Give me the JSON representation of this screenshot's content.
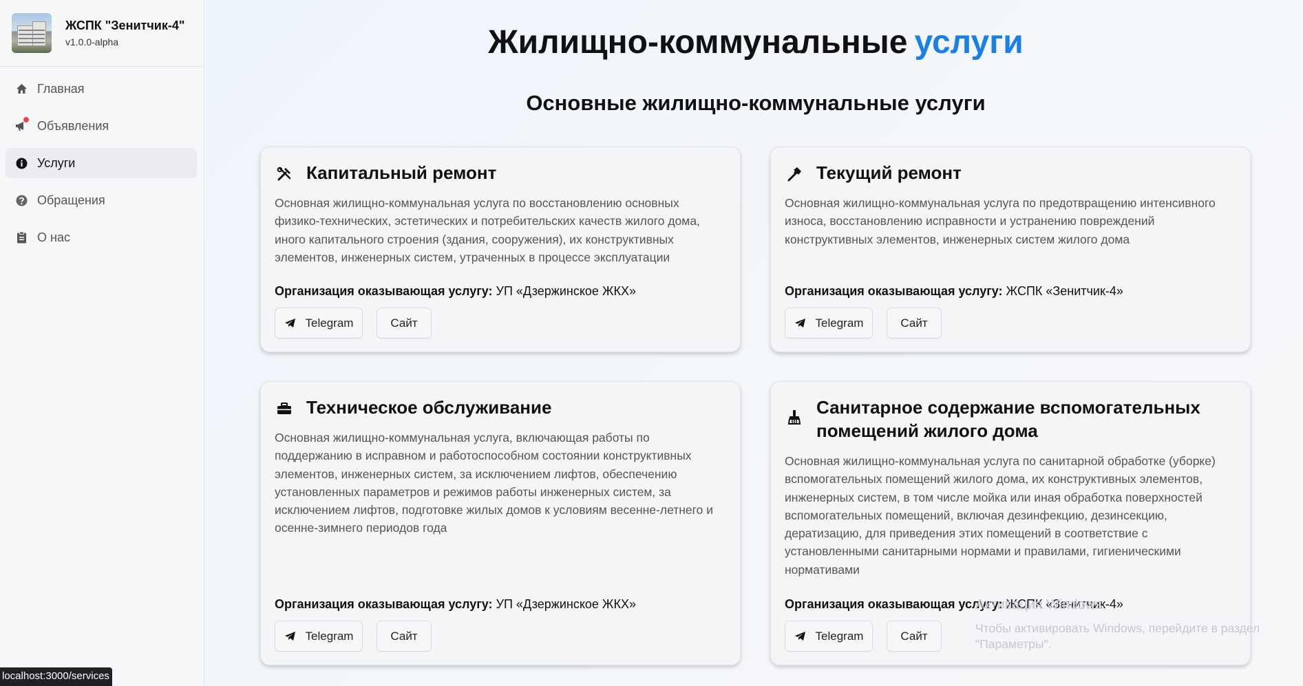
{
  "app": {
    "title": "ЖСПК \"Зенитчик-4\"",
    "version": "v1.0.0-alpha"
  },
  "nav": {
    "items": [
      {
        "label": "Главная",
        "icon": "home-icon"
      },
      {
        "label": "Объявления",
        "icon": "megaphone-icon",
        "badge": true
      },
      {
        "label": "Услуги",
        "icon": "info-icon",
        "active": true
      },
      {
        "label": "Обращения",
        "icon": "question-icon"
      },
      {
        "label": "О нас",
        "icon": "clipboard-icon"
      }
    ]
  },
  "page": {
    "title_main": "Жилищно-коммунальные",
    "title_accent": "услуги",
    "section_title": "Основные жилищно-коммунальные услуги",
    "accent_color": "#1a7fe6"
  },
  "org_label": "Организация оказывающая услугу:",
  "cards": [
    {
      "title": "Капитальный ремонт",
      "icon": "tools-icon",
      "description": "Основная жилищно-коммунальная услуга по восстановлению основных физико-технических, эстетических и потребительских качеств жилого дома, иного капитального строения (здания, сооружения), их конструктивных элементов, инженерных систем, утраченных в процессе эксплуатации",
      "org": "УП «Дзержинское ЖКХ»",
      "telegram_label": "Telegram",
      "site_label": "Сайт"
    },
    {
      "title": "Текущий ремонт",
      "icon": "hammer-icon",
      "description": "Основная жилищно-коммунальная услуга по предотвращению интенсивного износа, восстановлению исправности и устранению повреждений конструктивных элементов, инженерных систем жилого дома",
      "org": "ЖСПК «Зенитчик-4»",
      "telegram_label": "Telegram",
      "site_label": "Сайт"
    },
    {
      "title": "Техническое обслуживание",
      "icon": "toolbox-icon",
      "description": "Основная жилищно-коммунальная услуга, включающая работы по поддержанию в исправном и работоспособном состоянии конструктивных элементов, инженерных систем, за исключением лифтов, обеспечению установленных параметров и режимов работы инженерных систем, за исключением лифтов, подготовке жилых домов к условиям весенне-летнего и осенне-зимнего периодов года",
      "org": "УП «Дзержинское ЖКХ»",
      "telegram_label": "Telegram",
      "site_label": "Сайт"
    },
    {
      "title": "Санитарное содержание вспомогательных помещений жилого дома",
      "icon": "broom-icon",
      "description": "Основная жилищно-коммунальная услуга по санитарной обработке (уборке) вспомогательных помещений жилого дома, их конструктивных элементов, инженерных систем, в том числе мойка или иная обработка поверхностей вспомогательных помещений, включая дезинфекцию, дезинсекцию, дератизацию, для приведения этих помещений в соответствие с установленными санитарными нормами и правилами, гигиеническими нормативами",
      "org": "ЖСПК «Зенитчик-4»",
      "telegram_label": "Telegram",
      "site_label": "Сайт"
    }
  ],
  "watermark": {
    "line1": "Активация Windows",
    "line2": "Чтобы активировать Windows, перейдите в раздел \"Параметры\"."
  },
  "status_url": "localhost:3000/services"
}
